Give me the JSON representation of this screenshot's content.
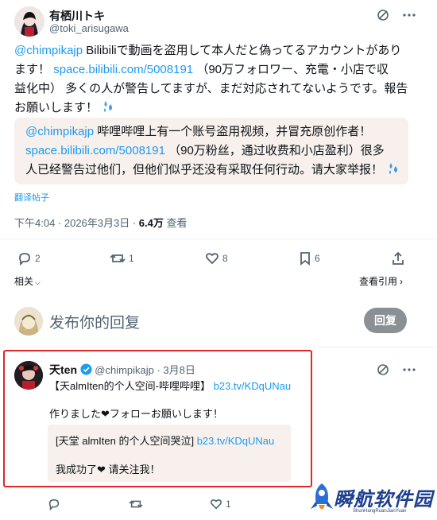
{
  "main_post": {
    "display_name": "有栖川トキ",
    "handle": "@toki_arisugawa",
    "text_line1_mention": "@chimpikajp",
    "text_line1_rest": " Bilibiliで動画を盗用して本人だと偽ってるアカウントがあり",
    "text_line2": "ます！",
    "text_line2_link": "space.bilibili.com/5008191",
    "text_line2_rest": "（90万フォロワー、充電・小店で収",
    "text_line3": "益化中） 多くの人が警告してますが、まだ対応されてないようです。報告",
    "text_line4": "お願いします！",
    "translation": {
      "line1_mention": "@chimpikajp",
      "line1_rest": " 哔哩哔哩上有一个账号盗用视频，并冒充原创作者！",
      "line2_link": "space.bilibili.com/5008191",
      "line2_rest": "（90万粉丝，通过收费和小店盈利）很多",
      "line3": "人已经警告过他们，但他们似乎还没有采取任何行动。请大家举报！"
    },
    "translate_label": "翻译帖子",
    "timestamp": "下午4:04 · 2026年3月3日 · ",
    "views_count": "6.4万",
    "views_label": " 查看",
    "replies": "2",
    "reposts": "1",
    "likes": "8",
    "bookmarks": "6",
    "related_label": "相关",
    "quotes_label": "查看引用"
  },
  "reply_composer": {
    "placeholder": "发布你的回复",
    "button_label": "回复"
  },
  "reply_post": {
    "display_name": "天ten",
    "handle": "@chimpikajp",
    "date": " · 3月8日",
    "line1_pre": "【天almIten的个人空间-哔哩哔哩】 ",
    "line1_link": "b23.tv/KDqUNau",
    "line2": "作りました❤︎フォローお願いします！",
    "quote_line1_pre": "[天堂 almIten 的个人空间哭泣] ",
    "quote_line1_link": "b23.tv/KDqUNau",
    "quote_line2": "我成功了❤︎ 请关注我！",
    "likes": "1"
  },
  "watermark": {
    "title": "瞬航软件园",
    "subtitle": "ShunHangRuanJianYuan"
  },
  "colors": {
    "link": "#1d9bf0",
    "highlight_frame": "#e0282a",
    "muted": "#536471"
  }
}
